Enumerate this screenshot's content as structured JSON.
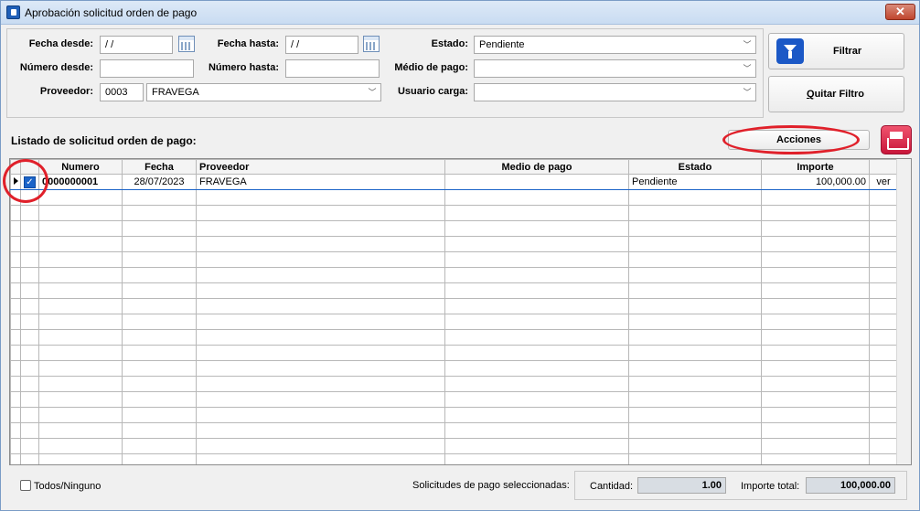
{
  "window": {
    "title": "Aprobación solicitud orden de pago"
  },
  "filters": {
    "fecha_desde_label": "Fecha desde:",
    "fecha_desde_value": " / /",
    "fecha_hasta_label": "Fecha hasta:",
    "fecha_hasta_value": " / /",
    "estado_label": "Estado:",
    "estado_value": "Pendiente",
    "numero_desde_label": "Número desde:",
    "numero_desde_value": "",
    "numero_hasta_label": "Número hasta:",
    "numero_hasta_value": "",
    "medio_pago_label": "Médio de pago:",
    "medio_pago_value": "",
    "proveedor_label": "Proveedor:",
    "proveedor_code": "0003",
    "proveedor_name": "FRAVEGA",
    "usuario_carga_label": "Usuario carga:",
    "usuario_carga_value": ""
  },
  "buttons": {
    "filtrar": "Filtrar",
    "quitar_filtro_underline": "Q",
    "quitar_filtro_rest": "uitar Filtro",
    "acciones": "Acciones"
  },
  "list": {
    "title": "Listado de solicitud orden de pago:",
    "columns": {
      "numero": "Numero",
      "fecha": "Fecha",
      "proveedor": "Proveedor",
      "medio_pago": "Medio de pago",
      "estado": "Estado",
      "importe": "Importe"
    },
    "rows": [
      {
        "checked": true,
        "numero": "0000000001",
        "fecha": "28/07/2023",
        "proveedor": "FRAVEGA",
        "medio_pago": "",
        "estado": "Pendiente",
        "importe": "100,000.00",
        "action": "ver"
      }
    ]
  },
  "footer": {
    "todos_label": "Todos/Ninguno",
    "seleccionadas_label": "Solicitudes de pago seleccionadas:",
    "cantidad_label": "Cantidad:",
    "cantidad_value": "1.00",
    "importe_total_label": "Importe total:",
    "importe_total_value": "100,000.00"
  },
  "colors": {
    "accent": "#1c64c8",
    "annotation_red": "#e0202a",
    "print_button": "#d81f45"
  }
}
